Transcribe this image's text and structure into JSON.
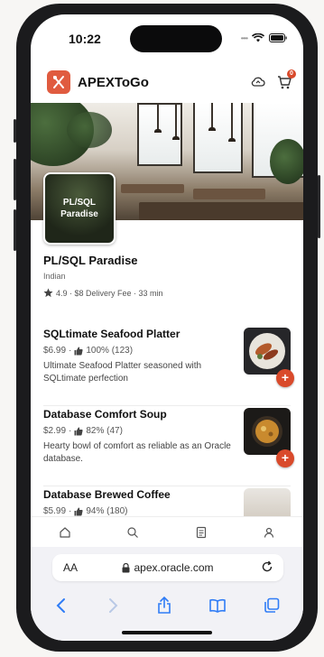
{
  "status_bar": {
    "time": "10:22"
  },
  "app": {
    "title": "APEXToGo",
    "cart_count": "0"
  },
  "restaurant": {
    "logo_text_line1": "PL/SQL",
    "logo_text_line2": "Paradise",
    "name": "PL/SQL Paradise",
    "cuisine": "Indian",
    "meta": "4.9 · $8 Delivery Fee · 33 min"
  },
  "menu_items": [
    {
      "name": "SQLtimate Seafood Platter",
      "price": "$6.99",
      "rating": "100% (123)",
      "description": "Ultimate Seafood Platter seasoned with SQLtimate perfection"
    },
    {
      "name": "Database Comfort Soup",
      "price": "$2.99",
      "rating": "82% (47)",
      "description": "Hearty bowl of comfort as reliable as an Oracle database."
    },
    {
      "name": "Database Brewed Coffee",
      "price": "$5.99",
      "rating": "94% (180)",
      "description": ""
    }
  ],
  "add_label": "+",
  "browser": {
    "text_size": "AA",
    "url": "apex.oracle.com"
  },
  "colors": {
    "accent": "#d94a2b",
    "logo_bg": "#e05b3f",
    "ios_blue": "#2f7cf6"
  },
  "icons": [
    "home-icon",
    "search-icon",
    "orders-icon",
    "profile-icon",
    "cloud-sync-icon",
    "cart-icon",
    "back-icon",
    "forward-icon",
    "share-icon",
    "bookmarks-icon",
    "tabs-icon",
    "lock-icon",
    "reload-icon"
  ]
}
